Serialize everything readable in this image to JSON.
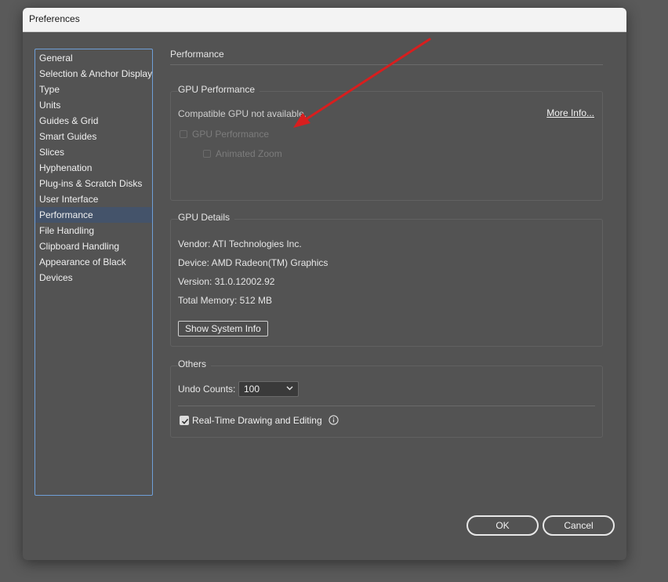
{
  "window": {
    "title": "Preferences"
  },
  "sidebar": {
    "items": [
      {
        "label": "General"
      },
      {
        "label": "Selection & Anchor Display"
      },
      {
        "label": "Type"
      },
      {
        "label": "Units"
      },
      {
        "label": "Guides & Grid"
      },
      {
        "label": "Smart Guides"
      },
      {
        "label": "Slices"
      },
      {
        "label": "Hyphenation"
      },
      {
        "label": "Plug-ins & Scratch Disks"
      },
      {
        "label": "User Interface"
      },
      {
        "label": "Performance"
      },
      {
        "label": "File Handling"
      },
      {
        "label": "Clipboard Handling"
      },
      {
        "label": "Appearance of Black"
      },
      {
        "label": "Devices"
      }
    ],
    "selected": "Performance"
  },
  "main": {
    "title": "Performance",
    "gpu_performance": {
      "title": "GPU Performance",
      "status": "Compatible GPU not available.",
      "more_info": "More Info...",
      "gpu_checkbox_label": "GPU Performance",
      "animated_zoom_label": "Animated Zoom"
    },
    "gpu_details": {
      "title": "GPU Details",
      "vendor": "Vendor: ATI Technologies Inc.",
      "device": "Device: AMD Radeon(TM) Graphics",
      "version": "Version: 31.0.12002.92",
      "memory": "Total Memory: 512 MB",
      "show_system_info": "Show System Info"
    },
    "others": {
      "title": "Others",
      "undo_label": "Undo Counts:",
      "undo_value": "100",
      "realtime_label": "Real-Time Drawing and Editing",
      "realtime_checked": true
    }
  },
  "footer": {
    "ok_label": "OK",
    "cancel_label": "Cancel"
  },
  "colors": {
    "annotation_arrow": "#d81e1e",
    "selection": "#44536a",
    "sidebar_border": "#6f9fd8"
  }
}
